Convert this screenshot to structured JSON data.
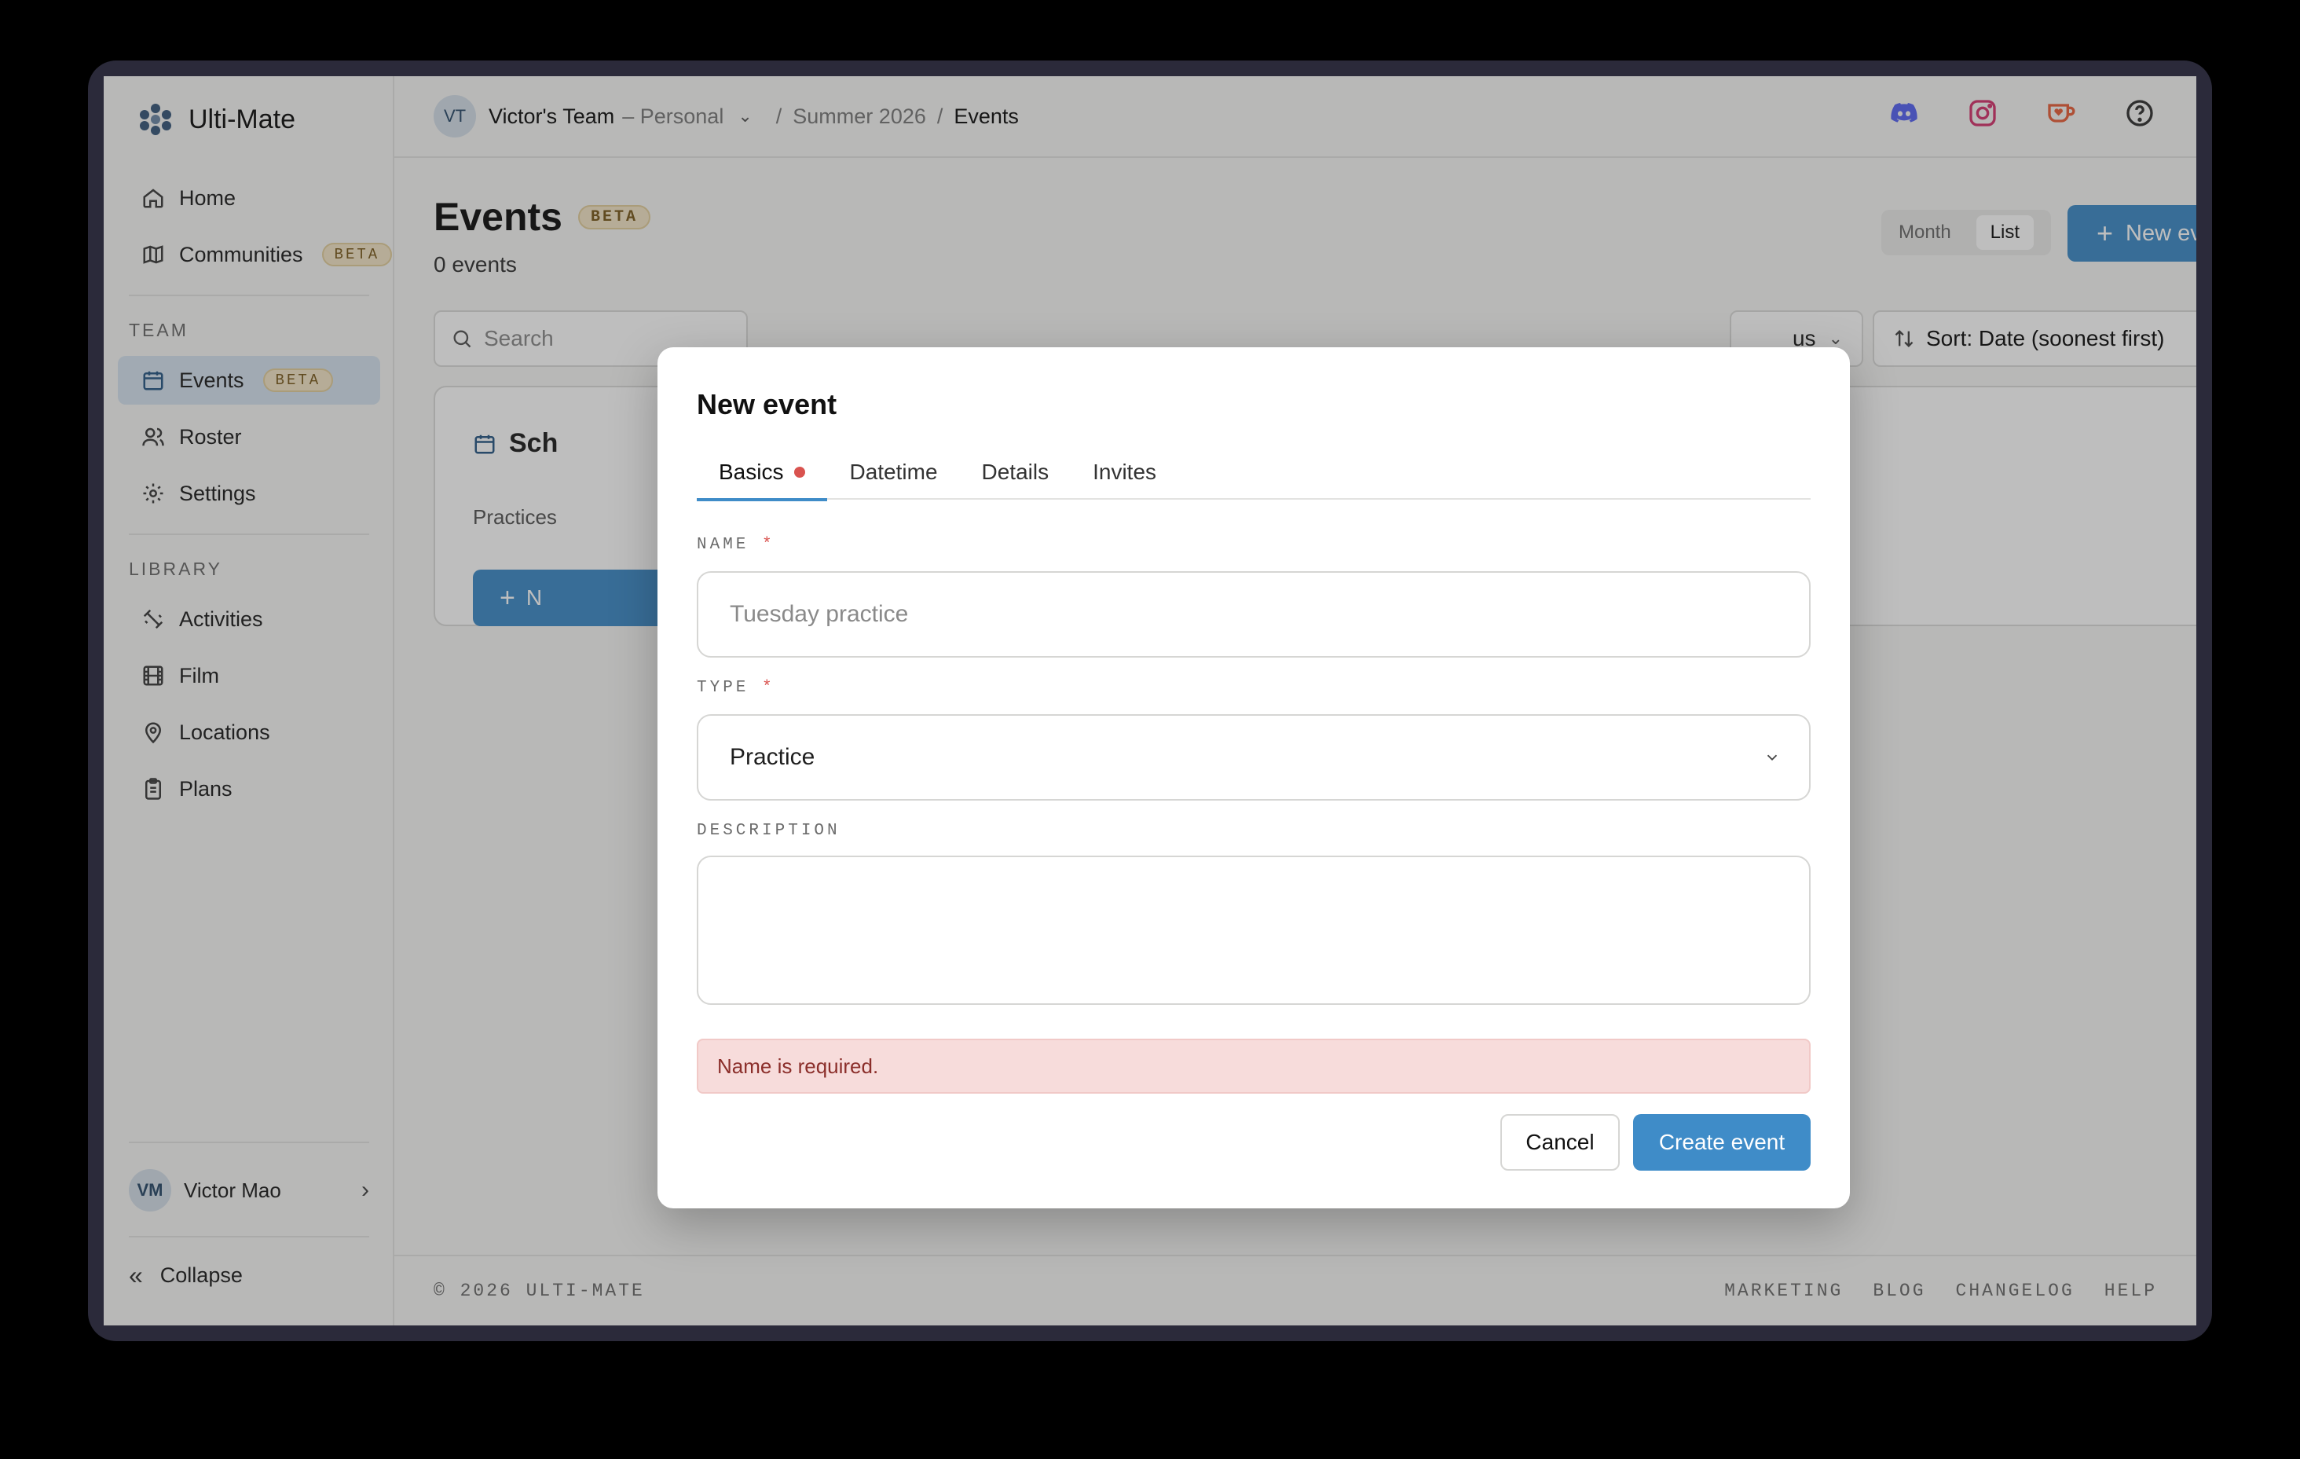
{
  "app": {
    "name": "Ulti-Mate"
  },
  "sidebar": {
    "top_items": [
      {
        "label": "Home",
        "icon": "home-icon"
      },
      {
        "label": "Communities",
        "icon": "map-icon",
        "badge": "BETA"
      }
    ],
    "team_label": "TEAM",
    "team_items": [
      {
        "label": "Events",
        "icon": "calendar-icon",
        "badge": "BETA",
        "active": true
      },
      {
        "label": "Roster",
        "icon": "users-icon"
      },
      {
        "label": "Settings",
        "icon": "gear-icon"
      }
    ],
    "library_label": "LIBRARY",
    "library_items": [
      {
        "label": "Activities",
        "icon": "dumbbell-icon"
      },
      {
        "label": "Film",
        "icon": "film-icon"
      },
      {
        "label": "Locations",
        "icon": "pin-icon"
      },
      {
        "label": "Plans",
        "icon": "clipboard-icon"
      }
    ],
    "user": {
      "initials": "VM",
      "name": "Victor Mao"
    },
    "collapse_label": "Collapse"
  },
  "header": {
    "team_initials": "VT",
    "team_name": "Victor's Team",
    "team_kind": "– Personal",
    "breadcrumb": [
      "Summer 2026",
      "Events"
    ]
  },
  "page": {
    "title": "Events",
    "badge": "BETA",
    "count_text": "0 events",
    "view_options": [
      "Month",
      "List"
    ],
    "view_selected": "List",
    "new_event_label": "New event",
    "search_placeholder": "Search",
    "status_filter_text": "us",
    "sort_label": "Sort: Date (soonest first)",
    "empty_title": "Sch",
    "empty_text": "Practices",
    "empty_button": "N"
  },
  "footer": {
    "copyright": "© 2026 ULTI-MATE",
    "links": [
      "MARKETING",
      "BLOG",
      "CHANGELOG",
      "HELP"
    ]
  },
  "modal": {
    "title": "New event",
    "tabs": [
      "Basics",
      "Datetime",
      "Details",
      "Invites"
    ],
    "active_tab": "Basics",
    "name_label": "NAME",
    "name_placeholder": "Tuesday practice",
    "type_label": "TYPE",
    "type_value": "Practice",
    "description_label": "DESCRIPTION",
    "required_mark": "*",
    "error_text": "Name is required.",
    "cancel_label": "Cancel",
    "create_label": "Create event"
  },
  "colors": {
    "accent": "#3f8cc8",
    "error": "#d9534f",
    "active_nav": "#d6e3ef"
  }
}
